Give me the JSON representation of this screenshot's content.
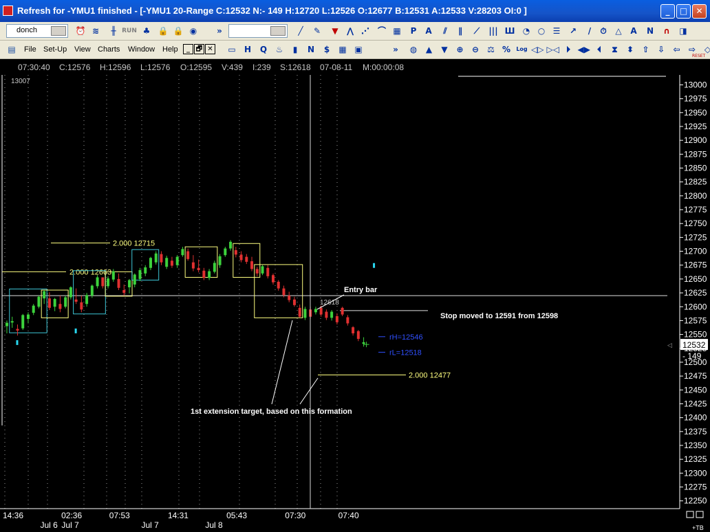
{
  "window": {
    "title": "Refresh for -YMU1 finished - [-YMU1 20-Range C:12532 N:- 149 H:12720 L:12526 O:12677 B:12531 A:12533 V:28203 OI:0 ]",
    "minimize_glyph": "_",
    "maximize_glyph": "□",
    "close_glyph": "✕"
  },
  "toolbar1": {
    "template_combo": "donch",
    "run_label": "RUN",
    "more_glyph": "»",
    "icons": [
      "alarm-clock-icon",
      "wave-icon",
      "candlestick-icon",
      "run-icon",
      "tree-icon",
      "lock-icon",
      "lock-icon",
      "ball-icon",
      "trend-line-icon",
      "pencil-icon",
      "arrow-down-icon",
      "fib-icon",
      "fib-fan-icon",
      "fib-arc-icon",
      "grid-icon",
      "p-icon",
      "a-icon",
      "channel-icon",
      "parallel-icon",
      "regression-icon",
      "bars-icon",
      "gann-icon",
      "cycle-icon",
      "circle-icon",
      "fib-lines-icon",
      "ray-icon",
      "line-icon",
      "clock-icon",
      "triangle-icon",
      "text-icon",
      "n-icon",
      "magnet-icon",
      "more-icon"
    ]
  },
  "toolbar2": {
    "menus": [
      "File",
      "Set-Up",
      "View",
      "Charts",
      "Window",
      "Help"
    ],
    "mdi": [
      "_",
      "🗗",
      "✕"
    ],
    "more_glyph": "»",
    "reset_label": "RESET"
  },
  "status": {
    "time": "07:30:40",
    "close": "C:12576",
    "high": "H:12596",
    "low": "L:12576",
    "open": "O:12595",
    "volume": "V:439",
    "index": "I:239",
    "s": "S:12618",
    "date": "07-08-11",
    "m": "M:00:00:08"
  },
  "chart_data": {
    "type": "candlestick",
    "symbol": "-YMU1 20-Range",
    "ylim": [
      12236,
      13008
    ],
    "y_ticks": [
      13000,
      12975,
      12950,
      12925,
      12900,
      12875,
      12850,
      12825,
      12800,
      12775,
      12750,
      12725,
      12700,
      12675,
      12650,
      12625,
      12600,
      12575,
      12550,
      12525,
      12500,
      12475,
      12450,
      12425,
      12400,
      12375,
      12350,
      12325,
      12300,
      12275,
      12250
    ],
    "top_left_value": "13007",
    "last_price_tag": "12532",
    "net_change_tag": "- 149",
    "x_labels": [
      {
        "bar": 0,
        "text": "14:36"
      },
      {
        "bar": 11,
        "text": "02:36"
      },
      {
        "bar": 20,
        "text": "07:53"
      },
      {
        "bar": 31,
        "text": "14:31"
      },
      {
        "bar": 42,
        "text": "05:43"
      },
      {
        "bar": 53,
        "text": "07:30"
      },
      {
        "bar": 63,
        "text": "07:40"
      }
    ],
    "date_labels": [
      {
        "bar": 6,
        "text": "Jul 6"
      },
      {
        "bar": 10,
        "text": "Jul 7"
      },
      {
        "bar": 25,
        "text": "Jul 7"
      },
      {
        "bar": 37,
        "text": "Jul 8"
      }
    ],
    "candles": [
      [
        12565,
        12575,
        12552,
        12571
      ],
      [
        12572,
        12582,
        12562,
        12574
      ],
      [
        12560,
        12568,
        12548,
        12557
      ],
      [
        12561,
        12587,
        12558,
        12585
      ],
      [
        12578,
        12590,
        12570,
        12586
      ],
      [
        12589,
        12605,
        12585,
        12602
      ],
      [
        12600,
        12620,
        12597,
        12618
      ],
      [
        12615,
        12630,
        12605,
        12628
      ],
      [
        12615,
        12626,
        12594,
        12598
      ],
      [
        12600,
        12616,
        12592,
        12614
      ],
      [
        12605,
        12620,
        12590,
        12596
      ],
      [
        12600,
        12620,
        12597,
        12617
      ],
      [
        12617,
        12637,
        12613,
        12635
      ],
      [
        12613,
        12633,
        12605,
        12609
      ],
      [
        12608,
        12620,
        12590,
        12595
      ],
      [
        12605,
        12625,
        12600,
        12621
      ],
      [
        12620,
        12640,
        12616,
        12638
      ],
      [
        12637,
        12657,
        12633,
        12653
      ],
      [
        12653,
        12648,
        12633,
        12637
      ],
      [
        12637,
        12655,
        12633,
        12651
      ],
      [
        12649,
        12668,
        12645,
        12664
      ],
      [
        12650,
        12660,
        12630,
        12634
      ],
      [
        12630,
        12640,
        12620,
        12625
      ],
      [
        12635,
        12650,
        12624,
        12648
      ],
      [
        12640,
        12660,
        12635,
        12658
      ],
      [
        12650,
        12670,
        12646,
        12666
      ],
      [
        12660,
        12675,
        12655,
        12671
      ],
      [
        12670,
        12690,
        12666,
        12688
      ],
      [
        12680,
        12700,
        12676,
        12696
      ],
      [
        12695,
        12700,
        12675,
        12680
      ],
      [
        12672,
        12692,
        12668,
        12688
      ],
      [
        12683,
        12690,
        12670,
        12674
      ],
      [
        12675,
        12693,
        12670,
        12690
      ],
      [
        12693,
        12708,
        12690,
        12704
      ],
      [
        12700,
        12705,
        12683,
        12686
      ],
      [
        12680,
        12693,
        12664,
        12669
      ],
      [
        12670,
        12685,
        12662,
        12666
      ],
      [
        12665,
        12670,
        12648,
        12652
      ],
      [
        12652,
        12668,
        12648,
        12664
      ],
      [
        12663,
        12683,
        12660,
        12679
      ],
      [
        12675,
        12695,
        12670,
        12691
      ],
      [
        12693,
        12708,
        12690,
        12705
      ],
      [
        12705,
        12720,
        12701,
        12717
      ],
      [
        12702,
        12708,
        12689,
        12694
      ],
      [
        12694,
        12700,
        12680,
        12684
      ],
      [
        12690,
        12695,
        12677,
        12681
      ],
      [
        12682,
        12690,
        12664,
        12668
      ],
      [
        12668,
        12672,
        12655,
        12660
      ],
      [
        12660,
        12675,
        12657,
        12673
      ],
      [
        12670,
        12675,
        12651,
        12655
      ],
      [
        12657,
        12660,
        12640,
        12644
      ],
      [
        12645,
        12648,
        12629,
        12633
      ],
      [
        12633,
        12638,
        12617,
        12621
      ],
      [
        12620,
        12627,
        12608,
        12612
      ],
      [
        12613,
        12618,
        12600,
        12603
      ],
      [
        12598,
        12604,
        12580,
        12582
      ],
      [
        12580,
        12600,
        12576,
        12596
      ],
      [
        12595,
        12600,
        12578,
        12582
      ],
      [
        12590,
        12600,
        12586,
        12596
      ],
      [
        12598,
        12602,
        12582,
        12586
      ],
      [
        12591,
        12595,
        12576,
        12580
      ],
      [
        12580,
        12594,
        12575,
        12591
      ],
      [
        12583,
        12588,
        12568,
        12572
      ],
      [
        12598,
        12600,
        12583,
        12586
      ],
      [
        12581,
        12585,
        12566,
        12570
      ],
      [
        12563,
        12565,
        12548,
        12552
      ],
      [
        12556,
        12558,
        12538,
        12542
      ],
      [
        12533,
        12545,
        12528,
        12536
      ]
    ],
    "boxes": [
      {
        "start": 1,
        "end": 7,
        "top": 12632,
        "bottom": 12553
      },
      {
        "start": 7,
        "end": 11,
        "top": 12630,
        "bottom": 12580
      },
      {
        "start": 13,
        "end": 18,
        "top": 12665,
        "bottom": 12587
      },
      {
        "start": 19,
        "end": 23,
        "top": 12663,
        "bottom": 12619
      },
      {
        "start": 24,
        "end": 28,
        "top": 12703,
        "bottom": 12648
      },
      {
        "start": 34,
        "end": 39,
        "top": 12708,
        "bottom": 12653
      },
      {
        "start": 43,
        "end": 47,
        "top": 12714,
        "bottom": 12653
      },
      {
        "start": 47,
        "end": 55,
        "top": 12676,
        "bottom": 12580
      }
    ],
    "ticks_cyan": [
      [
        2,
        12536
      ],
      [
        13,
        12557
      ],
      [
        69,
        12675
      ]
    ],
    "annotations": {
      "level_12715": "2.000  12715",
      "level_12663": "2.000  12663",
      "level_12477": "2.000  12477",
      "entry_bar": "Entry bar",
      "entry_price": "12618",
      "stop_note": "Stop moved to 12591 from 12598",
      "rh": "rH=12546",
      "rl": "rL=12518",
      "target_note": "1st extension target, based on this formation"
    },
    "grid": "dotted vertical session lines"
  }
}
